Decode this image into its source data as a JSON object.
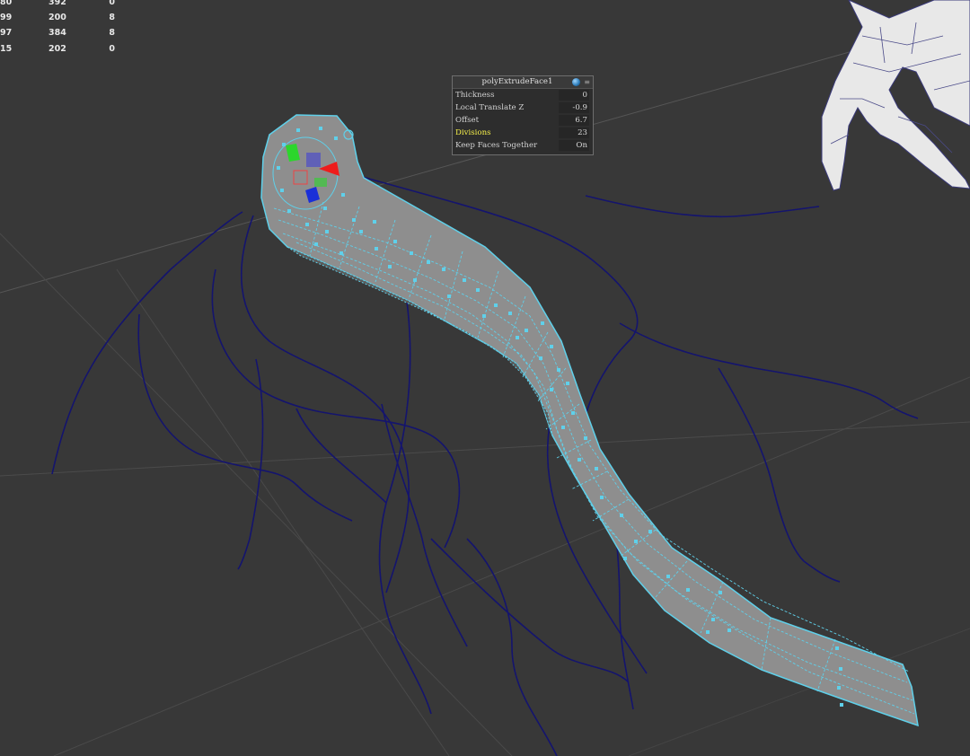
{
  "hud_stats": [
    {
      "a": "80",
      "b": "392",
      "c": "0"
    },
    {
      "a": "99",
      "b": "200",
      "c": "8"
    },
    {
      "a": "97",
      "b": "384",
      "c": "8"
    },
    {
      "a": "15",
      "b": "202",
      "c": "0"
    }
  ],
  "channel_box": {
    "title": "polyExtrudeFace1",
    "attributes": [
      {
        "label": "Thickness",
        "value": "0",
        "highlighted": false
      },
      {
        "label": "Local Translate Z",
        "value": "-0.9",
        "highlighted": false
      },
      {
        "label": "Offset",
        "value": "6.7",
        "highlighted": false
      },
      {
        "label": "Divisions",
        "value": "23",
        "highlighted": true
      },
      {
        "label": "Keep Faces Together",
        "value": "On",
        "highlighted": false
      }
    ],
    "highlight_color": "#f6ef4a"
  },
  "viewport": {
    "background": "#383838",
    "grid_color": "#5a5a5a",
    "curve_color": "#14146e",
    "selection_color": "#5fd0ea",
    "mesh_face_color": "#8f8f8f",
    "reference_mesh_color": "#e6e6e6",
    "manipulator_colors": {
      "x": "#ee1c1c",
      "y": "#2cd62c",
      "z": "#1a2fd8"
    }
  }
}
